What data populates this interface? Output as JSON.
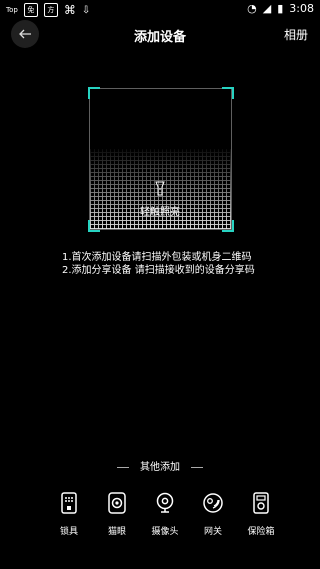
{
  "status_bar": {
    "carrier": "Top",
    "badge1": "免",
    "badge2": "方",
    "time": "3:08"
  },
  "header": {
    "title": "添加设备",
    "album": "相册"
  },
  "scanner": {
    "light_label": "轻触照亮"
  },
  "instructions": {
    "line1": "1.首次添加设备请扫描外包装或机身二维码",
    "line2": "2.添加分享设备 请扫描接收到的设备分享码"
  },
  "other_add": {
    "title": "其他添加",
    "items": [
      {
        "label": "锁具",
        "icon": "lock-icon"
      },
      {
        "label": "猫眼",
        "icon": "peephole-icon"
      },
      {
        "label": "摄像头",
        "icon": "camera-icon"
      },
      {
        "label": "网关",
        "icon": "gateway-icon"
      },
      {
        "label": "保险箱",
        "icon": "safe-icon"
      }
    ]
  }
}
